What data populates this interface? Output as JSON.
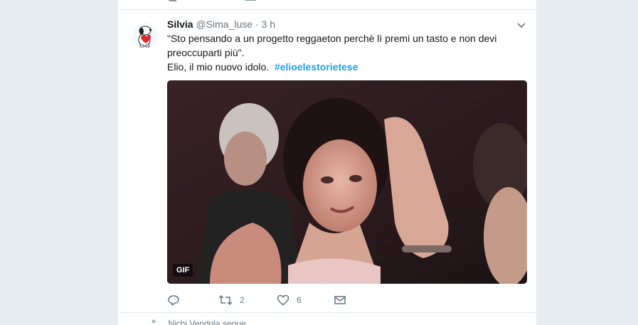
{
  "tweet": {
    "name": "Silvia",
    "handle": "@Sima_luse",
    "dot": "·",
    "time": "3 h",
    "text_line1": "\"Sto pensando a un progetto reggaeton perchè lì premi un tasto e non devi preoccuparti più\".",
    "text_line2": "Elio, il mio nuovo idolo.",
    "hashtag": "#elioelestorietese",
    "media_badge": "GIF",
    "retweet_count": "2",
    "like_count": "6"
  },
  "next_tweet": {
    "context": "Nichi Vendola segue"
  },
  "icons": {
    "caret": "chevron-down-icon",
    "reply": "reply-icon",
    "retweet": "retweet-icon",
    "like": "heart-icon",
    "dm": "envelope-icon",
    "follow": "person-icon"
  },
  "colors": {
    "link": "#1da1f2",
    "secondary_text": "#657786",
    "page_bg": "#e6ecf0"
  }
}
